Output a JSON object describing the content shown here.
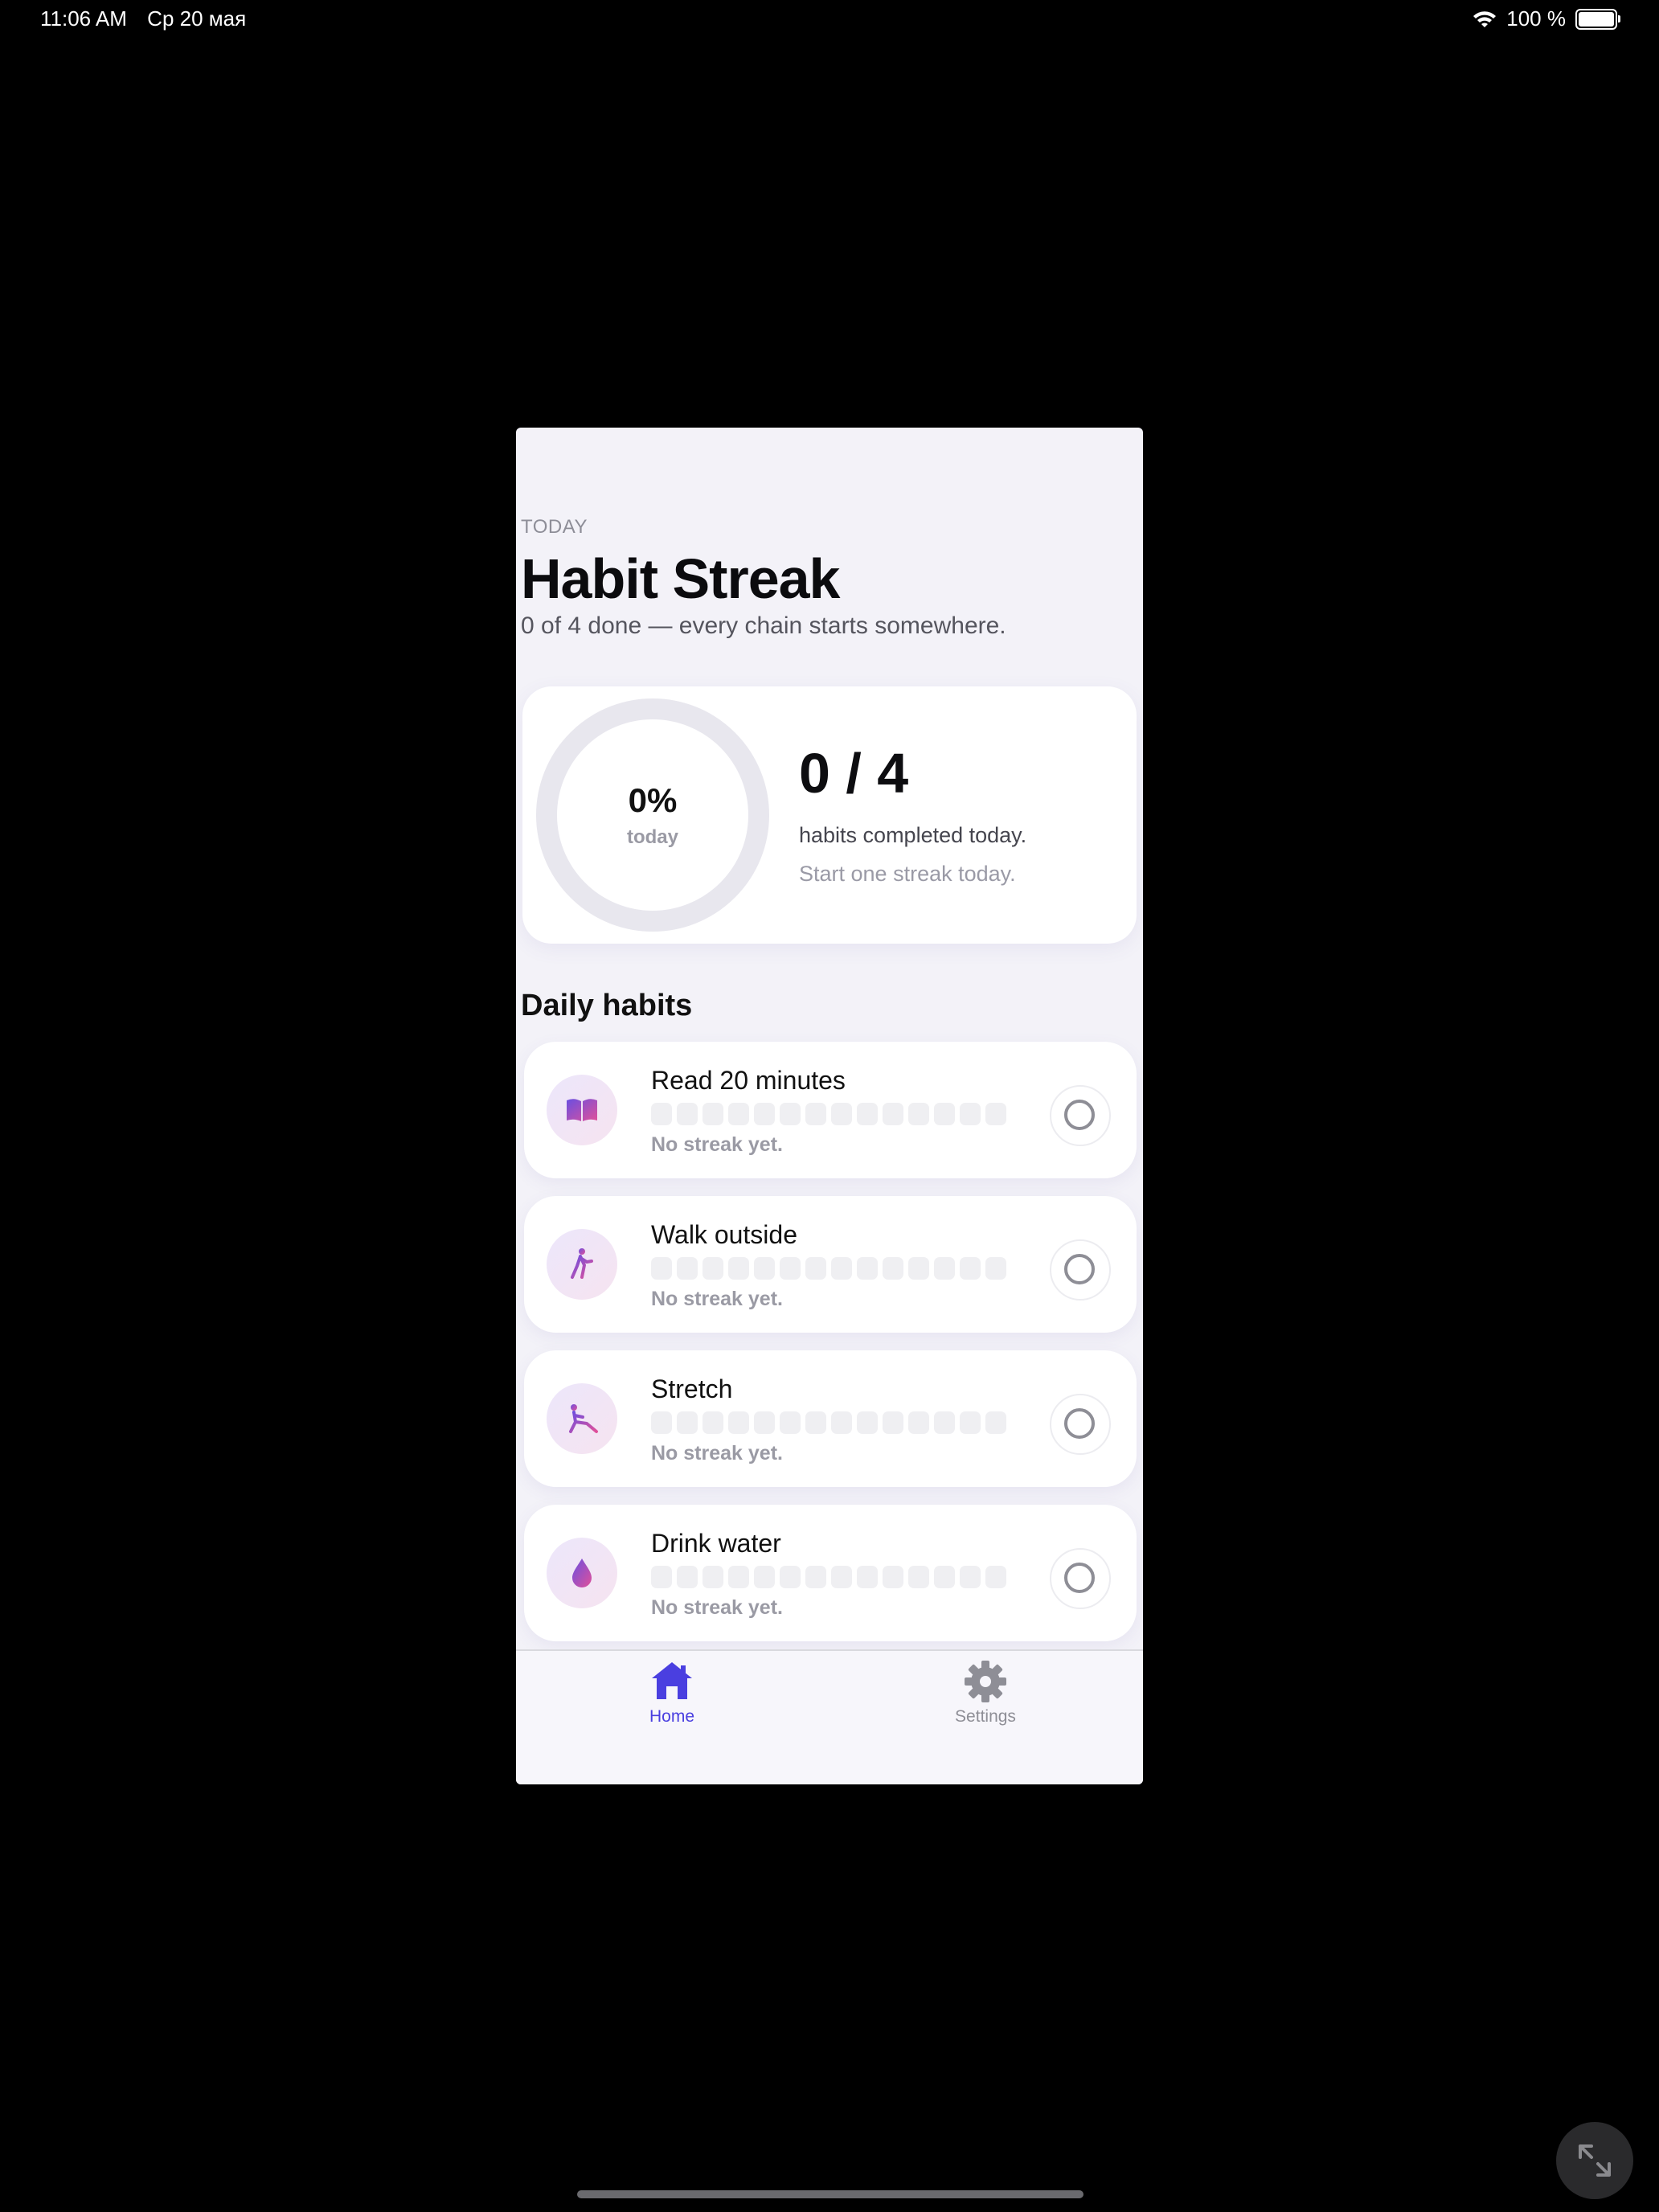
{
  "status_bar": {
    "time": "11:06 AM",
    "date": "Ср 20 мая",
    "battery": "100 %"
  },
  "header": {
    "eyebrow": "TODAY",
    "title": "Habit Streak",
    "subtitle": "0 of 4 done — every chain starts somewhere."
  },
  "summary": {
    "percent": "0%",
    "percent_label": "today",
    "progress": 0,
    "count": "0 / 4",
    "description": "habits completed today.",
    "hint": "Start one streak today."
  },
  "section_title": "Daily habits",
  "habits": [
    {
      "name": "Read 20 minutes",
      "icon": "book-icon",
      "streak": "No streak yet."
    },
    {
      "name": "Walk outside",
      "icon": "walk-icon",
      "streak": "No streak yet."
    },
    {
      "name": "Stretch",
      "icon": "stretch-icon",
      "streak": "No streak yet."
    },
    {
      "name": "Drink water",
      "icon": "water-drop-icon",
      "streak": "No streak yet."
    }
  ],
  "tabs": [
    {
      "label": "Home",
      "icon": "home-icon",
      "active": true
    },
    {
      "label": "Settings",
      "icon": "gear-icon",
      "active": false
    }
  ],
  "colors": {
    "accent": "#4a3fe0",
    "icon_gradient_start": "#6b4fe0",
    "icon_gradient_end": "#e0509a"
  }
}
